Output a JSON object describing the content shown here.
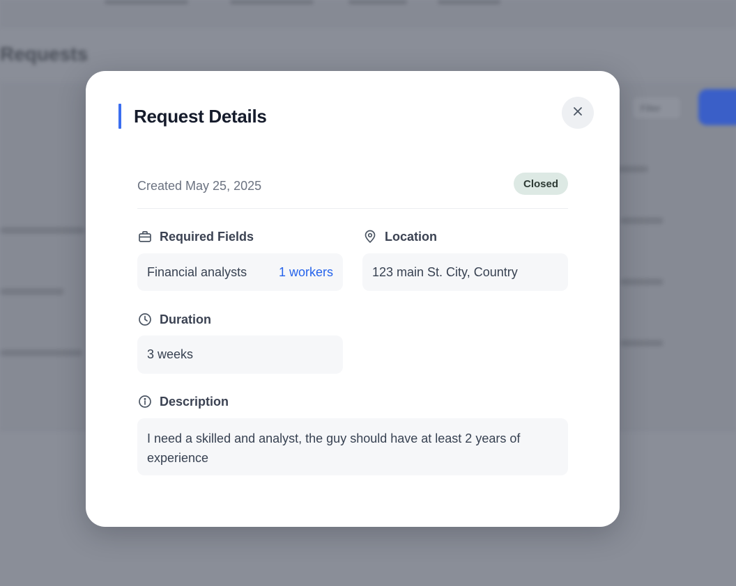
{
  "background": {
    "page_title": "Requests",
    "filter_label": "Filter"
  },
  "modal": {
    "title": "Request Details",
    "created": "Created May 25, 2025",
    "status": "Closed",
    "required_fields": {
      "label": "Required Fields",
      "icon": "briefcase-icon",
      "role": "Financial analysts",
      "workers": "1 workers"
    },
    "location": {
      "label": "Location",
      "icon": "map-pin-icon",
      "value": "123 main St. City, Country"
    },
    "duration": {
      "label": "Duration",
      "icon": "clock-icon",
      "value": "3 weeks"
    },
    "description": {
      "label": "Description",
      "icon": "info-icon",
      "value": "I need a skilled and analyst, the guy should have at least 2 years of experience"
    }
  },
  "colors": {
    "accent": "#3b6ef0",
    "link": "#2563eb",
    "badge_bg": "#dde9e4",
    "overlay": "#8a8e98"
  }
}
